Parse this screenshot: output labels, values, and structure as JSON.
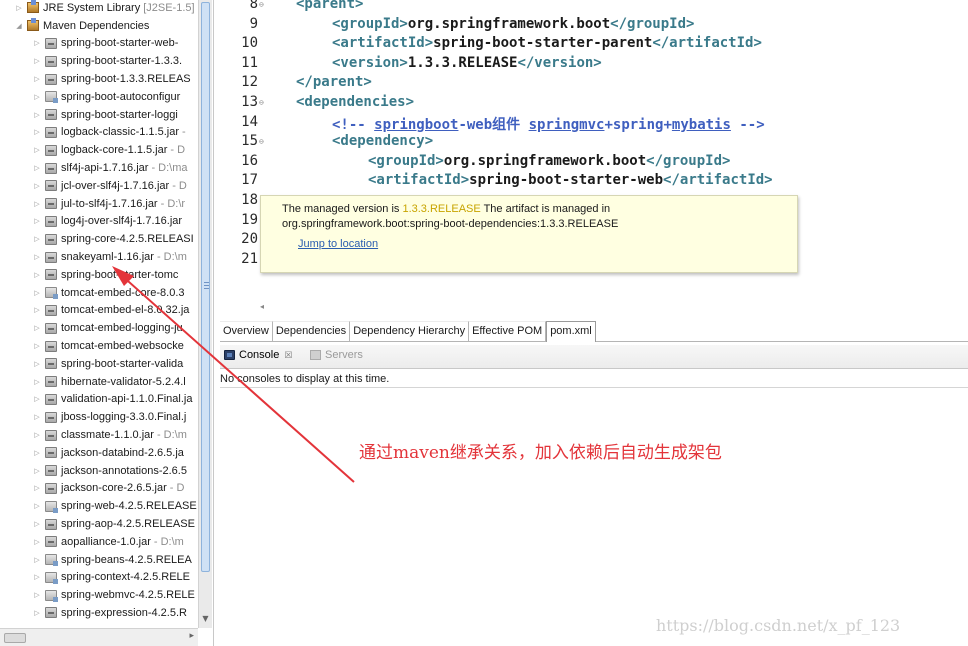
{
  "tree": {
    "items": [
      {
        "label": "JRE System Library",
        "suffix": "[J2SE-1.5]",
        "icon": "library-icon",
        "expanded": false
      },
      {
        "label": "Maven Dependencies",
        "suffix": "",
        "icon": "library-icon",
        "expanded": true
      },
      {
        "label": "spring-boot-starter-web-",
        "suffix": "",
        "icon": "jar-icon"
      },
      {
        "label": "spring-boot-starter-1.3.3.",
        "suffix": "",
        "icon": "jar-icon"
      },
      {
        "label": "spring-boot-1.3.3.RELEAS",
        "suffix": "",
        "icon": "jar-icon"
      },
      {
        "label": "spring-boot-autoconfigur",
        "suffix": "",
        "icon": "jar-source-icon"
      },
      {
        "label": "spring-boot-starter-loggi",
        "suffix": "",
        "icon": "jar-icon"
      },
      {
        "label": "logback-classic-1.1.5.jar",
        "suffix": "-",
        "icon": "jar-icon"
      },
      {
        "label": "logback-core-1.1.5.jar",
        "suffix": "- D",
        "icon": "jar-icon"
      },
      {
        "label": "slf4j-api-1.7.16.jar",
        "suffix": "- D:\\ma",
        "icon": "jar-icon"
      },
      {
        "label": "jcl-over-slf4j-1.7.16.jar",
        "suffix": "- D",
        "icon": "jar-icon"
      },
      {
        "label": "jul-to-slf4j-1.7.16.jar",
        "suffix": "- D:\\r",
        "icon": "jar-icon"
      },
      {
        "label": "log4j-over-slf4j-1.7.16.jar",
        "suffix": "",
        "icon": "jar-icon"
      },
      {
        "label": "spring-core-4.2.5.RELEASI",
        "suffix": "",
        "icon": "jar-icon"
      },
      {
        "label": "snakeyaml-1.16.jar",
        "suffix": "- D:\\m",
        "icon": "jar-icon"
      },
      {
        "label": "spring-boot-starter-tomc",
        "suffix": "",
        "icon": "jar-icon"
      },
      {
        "label": "tomcat-embed-core-8.0.3",
        "suffix": "",
        "icon": "jar-source-icon"
      },
      {
        "label": "tomcat-embed-el-8.0.32.ja",
        "suffix": "",
        "icon": "jar-icon"
      },
      {
        "label": "tomcat-embed-logging-ju",
        "suffix": "",
        "icon": "jar-icon"
      },
      {
        "label": "tomcat-embed-websocke",
        "suffix": "",
        "icon": "jar-icon"
      },
      {
        "label": "spring-boot-starter-valida",
        "suffix": "",
        "icon": "jar-icon"
      },
      {
        "label": "hibernate-validator-5.2.4.l",
        "suffix": "",
        "icon": "jar-icon"
      },
      {
        "label": "validation-api-1.1.0.Final.ja",
        "suffix": "",
        "icon": "jar-icon"
      },
      {
        "label": "jboss-logging-3.3.0.Final.j",
        "suffix": "",
        "icon": "jar-icon"
      },
      {
        "label": "classmate-1.1.0.jar",
        "suffix": "- D:\\m",
        "icon": "jar-icon"
      },
      {
        "label": "jackson-databind-2.6.5.ja",
        "suffix": "",
        "icon": "jar-icon"
      },
      {
        "label": "jackson-annotations-2.6.5",
        "suffix": "",
        "icon": "jar-icon"
      },
      {
        "label": "jackson-core-2.6.5.jar",
        "suffix": "- D",
        "icon": "jar-icon"
      },
      {
        "label": "spring-web-4.2.5.RELEASE",
        "suffix": "",
        "icon": "jar-source-icon"
      },
      {
        "label": "spring-aop-4.2.5.RELEASE",
        "suffix": "",
        "icon": "jar-icon"
      },
      {
        "label": "aopalliance-1.0.jar",
        "suffix": "- D:\\m",
        "icon": "jar-icon"
      },
      {
        "label": "spring-beans-4.2.5.RELEA",
        "suffix": "",
        "icon": "jar-source-icon"
      },
      {
        "label": "spring-context-4.2.5.RELE",
        "suffix": "",
        "icon": "jar-source-icon"
      },
      {
        "label": "spring-webmvc-4.2.5.RELE",
        "suffix": "",
        "icon": "jar-source-icon"
      },
      {
        "label": "spring-expression-4.2.5.R",
        "suffix": "",
        "icon": "jar-icon"
      }
    ]
  },
  "editor": {
    "lines": [
      {
        "no": "8",
        "fold": true,
        "parts": [
          [
            "tg",
            "<parent>"
          ]
        ]
      },
      {
        "no": "9",
        "fold": false,
        "parts": [
          [
            "tg",
            "<groupId>"
          ],
          [
            "tx",
            "org.springframework.boot"
          ],
          [
            "tg",
            "</groupId>"
          ]
        ]
      },
      {
        "no": "10",
        "fold": false,
        "parts": [
          [
            "tg",
            "<artifactId>"
          ],
          [
            "tx",
            "spring-boot-starter-parent"
          ],
          [
            "tg",
            "</artifactId>"
          ]
        ]
      },
      {
        "no": "11",
        "fold": false,
        "parts": [
          [
            "tg",
            "<version>"
          ],
          [
            "tx",
            "1.3.3.RELEASE"
          ],
          [
            "tg",
            "</version>"
          ]
        ]
      },
      {
        "no": "12",
        "fold": false,
        "parts": [
          [
            "tg",
            "</parent>"
          ]
        ]
      },
      {
        "no": "13",
        "fold": true,
        "parts": [
          [
            "tg",
            "<dependencies>"
          ]
        ]
      },
      {
        "no": "14",
        "fold": false,
        "parts": [
          [
            "cm",
            "<!-- "
          ],
          [
            "cu",
            "springboot"
          ],
          [
            "cm",
            "-web组件 "
          ],
          [
            "cu",
            "springmvc"
          ],
          [
            "cm",
            "+spring+"
          ],
          [
            "cu",
            "mybatis"
          ],
          [
            "cm",
            " -->"
          ]
        ]
      },
      {
        "no": "15",
        "fold": true,
        "parts": [
          [
            "tg",
            "<dependency>"
          ]
        ]
      },
      {
        "no": "16",
        "fold": false,
        "parts": [
          [
            "tg",
            "<groupId>"
          ],
          [
            "tx",
            "org.springframework.boot"
          ],
          [
            "tg",
            "</groupId>"
          ]
        ]
      },
      {
        "no": "17",
        "fold": false,
        "parts": [
          [
            "tg",
            "<artifactId>"
          ],
          [
            "tx",
            "spring-boot-starter-web"
          ],
          [
            "tg",
            "</artifactId>"
          ]
        ]
      },
      {
        "no": "18",
        "fold": false,
        "parts": []
      },
      {
        "no": "19",
        "fold": false,
        "parts": []
      },
      {
        "no": "20",
        "fold": false,
        "parts": []
      },
      {
        "no": "21",
        "fold": false,
        "parts": []
      }
    ],
    "indents": [
      2,
      3,
      3,
      3,
      2,
      2,
      3,
      3,
      4,
      4,
      0,
      0,
      0,
      0
    ]
  },
  "tooltip": {
    "prefix": "The managed version is ",
    "version": "1.3.3.RELEASE",
    "rest": " The artifact is managed in",
    "line2": "org.springframework.boot:spring-boot-dependencies:1.3.3.RELEASE",
    "link": "Jump to location"
  },
  "editor_tabs": [
    "Overview",
    "Dependencies",
    "Dependency Hierarchy",
    "Effective POM",
    "pom.xml"
  ],
  "active_editor_tab": "pom.xml",
  "console": {
    "tab_console": "Console",
    "tab_close": "☒",
    "tab_servers": "Servers",
    "message": "No consoles to display at this time."
  },
  "annotation": {
    "text": "通过maven继承关系，加入依赖后自动生成架包",
    "color": "#e3343a"
  },
  "watermark": "https://blog.csdn.net/x_pf_123"
}
